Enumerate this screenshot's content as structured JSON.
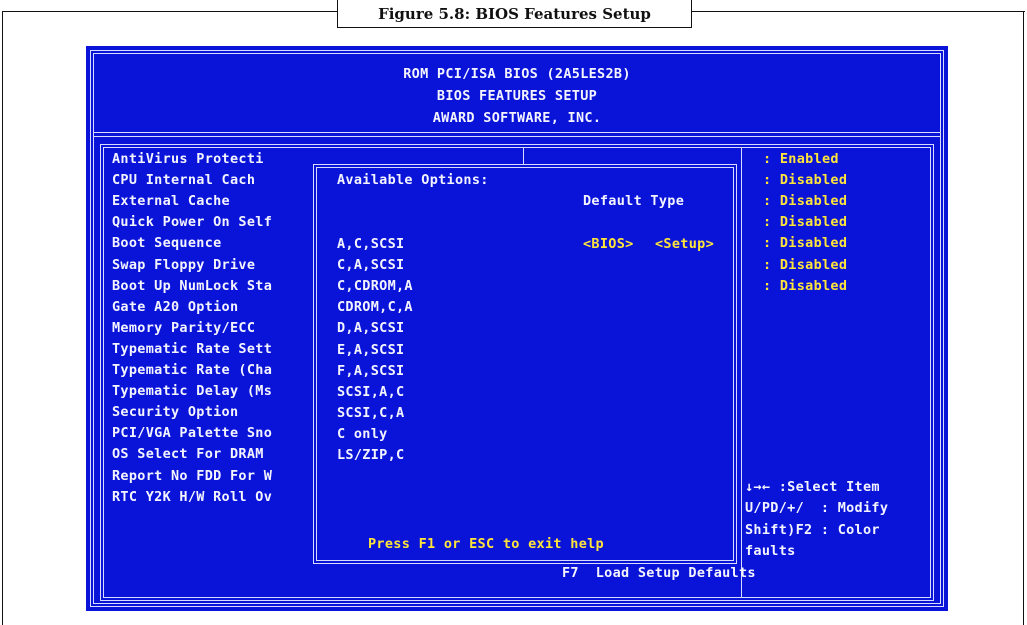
{
  "figure_caption": "Figure 5.8: BIOS Features Setup",
  "header": {
    "line1": "ROM PCI/ISA BIOS (2A5LES2B)",
    "line2": "BIOS FEATURES SETUP",
    "line3": "AWARD SOFTWARE, INC."
  },
  "settings": [
    "AntiVirus Protecti",
    "CPU Internal Cach",
    "External Cache",
    "Quick Power On Self",
    "Boot Sequence",
    "Swap Floppy Drive",
    "Boot Up NumLock Sta",
    "Gate A20 Option",
    "Memory Parity/ECC",
    "Typematic Rate Sett",
    "Typematic Rate (Cha",
    "Typematic Delay (Ms",
    "Security Option",
    "PCI/VGA Palette Sno",
    "OS Select For DRAM",
    "Report No FDD For W",
    "RTC Y2K H/W Roll Ov"
  ],
  "values": [
    ": Enabled",
    ": Disabled",
    ": Disabled",
    ": Disabled",
    ": Disabled",
    ": Disabled",
    ": Disabled"
  ],
  "popup": {
    "title": "Available Options:",
    "default_type_label": "Default Type",
    "bios_tag": "<BIOS>",
    "setup_tag": "<Setup>",
    "options": [
      "A,C,SCSI",
      "C,A,SCSI",
      "C,CDROM,A",
      "CDROM,C,A",
      "D,A,SCSI",
      "E,A,SCSI",
      "F,A,SCSI",
      "SCSI,A,C",
      "SCSI,C,A",
      "C only",
      "LS/ZIP,C"
    ],
    "footer": "Press F1 or ESC to exit help"
  },
  "help_keys": [
    "↓→← :Select Item",
    "U/PD/+/  : Modify",
    "Shift)F2 : Color",
    "faults"
  ],
  "bottom_hint": "F7  Load Setup Defaults",
  "colors": {
    "screen_bg": "#0a14d8",
    "text": "#f4f4ff",
    "highlight": "#ffe53a"
  }
}
